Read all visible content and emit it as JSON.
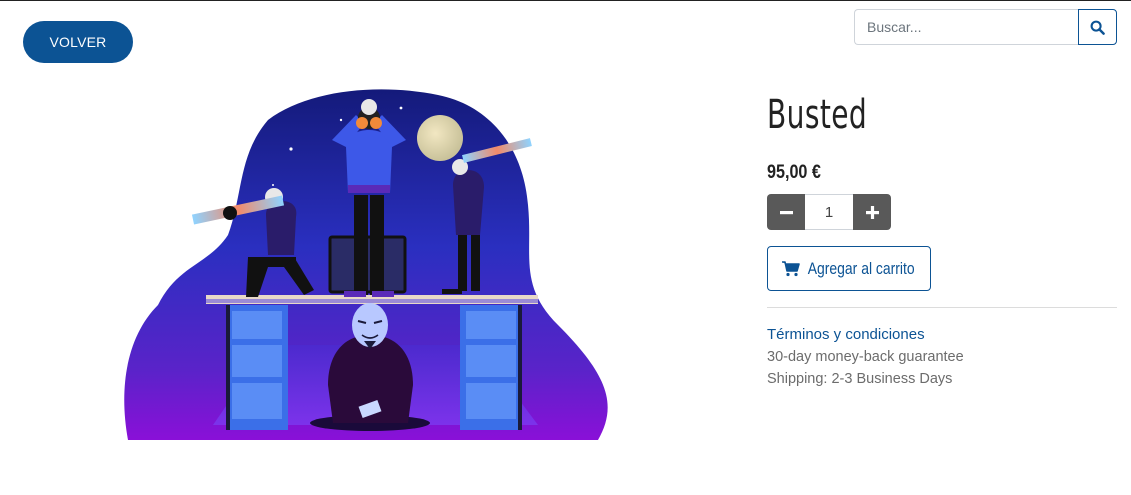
{
  "nav": {
    "back_label": "VOLVER"
  },
  "search": {
    "placeholder": "Buscar..."
  },
  "product": {
    "name": "Busted",
    "price": "95,00 €",
    "quantity": "1",
    "add_to_cart_label": "Agregar al carrito",
    "terms_label": "Términos y condiciones",
    "info": [
      "30-day money-back guarantee",
      "Shipping: 2-3 Business Days"
    ]
  },
  "colors": {
    "brand": "#0c5394",
    "stepper": "#595959"
  },
  "icons": {
    "search": "search-icon",
    "minus": "minus-icon",
    "plus": "plus-icon",
    "cart": "cart-icon"
  }
}
